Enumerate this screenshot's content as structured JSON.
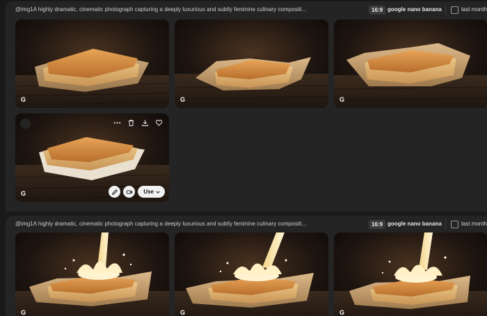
{
  "groups": [
    {
      "prompt": "@img1A highly dramatic, cinematic photograph capturing a deeply luxurious and subtly feminine culinary compositi...",
      "aspect_ratio": "16:9",
      "model": "google nano banana",
      "filter_label": "last month",
      "images": [
        {
          "badge": "G"
        },
        {
          "badge": "G"
        },
        {
          "badge": "G"
        },
        {
          "badge": "G",
          "use_label": "Use"
        }
      ]
    },
    {
      "prompt": "@img1A highly dramatic, cinematic photograph capturing a deeply luxurious and subtly feminine culinary compositi...",
      "aspect_ratio": "16:9",
      "model": "google nano banana",
      "filter_label": "last month",
      "images": [
        {
          "badge": "G"
        },
        {
          "badge": "G"
        },
        {
          "badge": "G"
        }
      ]
    }
  ],
  "colors": {
    "page_bg": "#191919",
    "panel_bg": "#242424",
    "button_bg": "#f2f2f2"
  }
}
